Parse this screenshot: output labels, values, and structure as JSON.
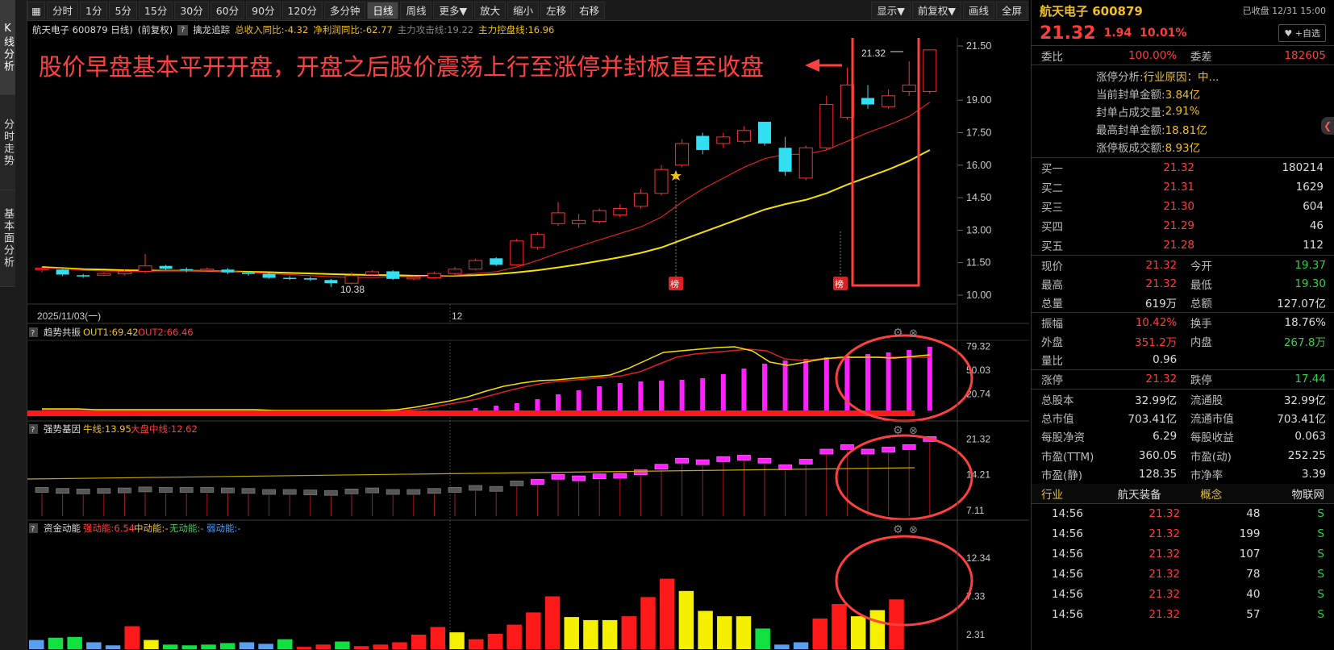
{
  "left_tabs": [
    {
      "label": "K线分析",
      "active": true
    },
    {
      "label": "分时走势",
      "active": false
    },
    {
      "label": "基本面分析",
      "active": false
    }
  ],
  "toolbar": {
    "periods": [
      "分时",
      "1分",
      "5分",
      "15分",
      "30分",
      "60分",
      "90分",
      "120分",
      "多分钟",
      "日线",
      "周线",
      "更多▼"
    ],
    "active_period": "日线",
    "actions": [
      "放大",
      "缩小",
      "左移",
      "右移"
    ],
    "display": "显示▼",
    "adjust": "前复权▼",
    "draw": "画线",
    "fullscreen": "全屏"
  },
  "info_bar": {
    "stock": "航天电子 600879 日线)",
    "adjust": "(前复权)",
    "indicator": "擒龙追踪",
    "rev": "总收入同比:-4.32",
    "profit": "净利润同比:-62.77",
    "attack": "主力攻击线:19.22",
    "control": "主力控盘线:16.96"
  },
  "chart": {
    "annotation": "股价早盘基本平开开盘，开盘之后股价震荡上行至涨停并封板直至收盘",
    "date_left": "2025/11/03(一)",
    "date_mid": "12",
    "high_label": "21.32",
    "low_label": "10.38",
    "badge": "榜",
    "price_ticks": [
      "21.50",
      "19.00",
      "17.50",
      "16.00",
      "14.50",
      "13.00",
      "11.50",
      "10.00"
    ],
    "panel1": {
      "name": "趋势共振",
      "out1": "OUT1:69.42",
      "out2": "OUT2:66.46",
      "ticks": [
        "79.32",
        "50.03",
        "20.74"
      ]
    },
    "panel2": {
      "name": "强势基因",
      "niu": "牛线:13.95",
      "dapan": "大盘中线:12.62",
      "ticks": [
        "21.32",
        "14.21",
        "7.11"
      ]
    },
    "panel3": {
      "name": "资金动能",
      "strong": "强动能:6.54",
      "mid": "中动能:-",
      "none": "无动能:-",
      "weak": "弱动能:-",
      "ticks": [
        "12.34",
        "7.33",
        "2.31"
      ]
    }
  },
  "chart_data": {
    "type": "candlestick",
    "candles": [
      [
        11.18,
        11.25,
        11.05,
        11.3
      ],
      [
        11.18,
        10.95,
        10.88,
        11.22
      ],
      [
        10.92,
        10.88,
        10.8,
        10.98
      ],
      [
        10.92,
        11.0,
        10.88,
        11.05
      ],
      [
        10.98,
        11.1,
        10.92,
        11.18
      ],
      [
        11.1,
        11.35,
        11.0,
        11.9
      ],
      [
        11.35,
        11.22,
        11.15,
        11.4
      ],
      [
        11.2,
        11.18,
        11.05,
        11.28
      ],
      [
        11.15,
        11.2,
        11.1,
        11.28
      ],
      [
        11.18,
        11.05,
        10.98,
        11.25
      ],
      [
        11.05,
        10.98,
        10.9,
        11.12
      ],
      [
        10.98,
        10.8,
        10.75,
        11.02
      ],
      [
        10.8,
        10.78,
        10.7,
        10.88
      ],
      [
        10.78,
        10.72,
        10.65,
        10.85
      ],
      [
        10.7,
        10.55,
        10.38,
        10.75
      ],
      [
        10.55,
        10.9,
        10.5,
        11.05
      ],
      [
        10.95,
        11.08,
        10.9,
        11.15
      ],
      [
        11.1,
        10.75,
        10.7,
        11.15
      ],
      [
        10.75,
        10.82,
        10.7,
        10.9
      ],
      [
        10.8,
        11.0,
        10.78,
        11.08
      ],
      [
        11.0,
        11.2,
        10.95,
        11.3
      ],
      [
        11.2,
        11.6,
        11.15,
        11.68
      ],
      [
        11.7,
        11.4,
        11.35,
        11.75
      ],
      [
        11.4,
        12.5,
        11.35,
        12.6
      ],
      [
        12.2,
        12.8,
        12.1,
        12.9
      ],
      [
        13.3,
        13.8,
        13.2,
        14.3
      ],
      [
        13.3,
        13.45,
        13.1,
        13.75
      ],
      [
        13.4,
        13.9,
        13.3,
        14.0
      ],
      [
        13.7,
        14.0,
        13.6,
        14.2
      ],
      [
        14.1,
        14.7,
        14.0,
        14.9
      ],
      [
        14.7,
        15.8,
        14.6,
        16.0
      ],
      [
        16.0,
        17.0,
        15.9,
        17.2
      ],
      [
        17.35,
        16.7,
        16.5,
        17.5
      ],
      [
        17.0,
        17.3,
        16.8,
        17.5
      ],
      [
        17.1,
        17.6,
        17.0,
        17.8
      ],
      [
        18.0,
        17.0,
        16.9,
        18.0
      ],
      [
        16.8,
        15.7,
        15.5,
        17.3
      ],
      [
        15.4,
        16.8,
        15.3,
        16.9
      ],
      [
        16.8,
        18.8,
        16.7,
        19.2
      ],
      [
        18.2,
        19.7,
        18.1,
        20.5
      ],
      [
        19.1,
        18.8,
        18.6,
        19.7
      ],
      [
        18.7,
        19.2,
        18.6,
        19.5
      ],
      [
        19.4,
        19.7,
        19.2,
        20.8
      ],
      [
        19.4,
        21.32,
        19.3,
        21.32
      ]
    ],
    "ma_red": [
      11.25,
      11.22,
      11.15,
      11.12,
      11.1,
      11.1,
      11.12,
      11.12,
      11.12,
      11.1,
      11.05,
      11.0,
      10.95,
      10.9,
      10.85,
      10.82,
      10.82,
      10.85,
      10.85,
      10.88,
      10.92,
      11.0,
      11.08,
      11.3,
      11.6,
      11.95,
      12.25,
      12.55,
      12.85,
      13.15,
      13.6,
      14.3,
      14.9,
      15.4,
      15.9,
      16.3,
      16.5,
      16.5,
      16.7,
      17.1,
      17.5,
      17.85,
      18.25,
      18.9
    ],
    "ma_yellow": [
      11.3,
      11.25,
      11.2,
      11.18,
      11.15,
      11.14,
      11.13,
      11.13,
      11.12,
      11.1,
      11.08,
      11.06,
      11.03,
      11.0,
      10.97,
      10.95,
      10.93,
      10.92,
      10.9,
      10.89,
      10.9,
      10.92,
      10.97,
      11.05,
      11.15,
      11.28,
      11.42,
      11.58,
      11.75,
      11.95,
      12.2,
      12.55,
      12.9,
      13.25,
      13.6,
      13.95,
      14.2,
      14.4,
      14.7,
      15.1,
      15.45,
      15.8,
      16.2,
      16.7
    ],
    "panel1_bars": [
      0,
      0,
      0,
      0,
      0,
      0,
      0,
      0,
      0,
      0,
      0,
      0,
      0,
      0,
      0,
      0,
      0,
      0,
      0,
      0,
      0,
      3,
      6,
      9,
      14,
      20,
      25,
      30,
      34,
      36,
      37,
      38,
      40,
      45,
      52,
      58,
      62,
      64,
      66,
      68,
      70,
      72,
      75,
      79
    ],
    "panel1_line_yellow": [
      2,
      2,
      2,
      1,
      1,
      1,
      1,
      1,
      1,
      1,
      1,
      1,
      1,
      0,
      0,
      0,
      0,
      0,
      0,
      0,
      1,
      4,
      8,
      12,
      17,
      24,
      30,
      34,
      37,
      38,
      40,
      42,
      44,
      52,
      62,
      72,
      74,
      76,
      78,
      79,
      74,
      60,
      56,
      60,
      64,
      66,
      66,
      66,
      65,
      67,
      69
    ],
    "panel1_line_red": [
      1,
      1,
      1,
      1,
      1,
      1,
      1,
      1,
      1,
      1,
      1,
      1,
      1,
      0,
      0,
      0,
      0,
      0,
      0,
      0,
      0,
      2,
      6,
      10,
      14,
      20,
      26,
      31,
      35,
      37,
      39,
      41,
      43,
      48,
      57,
      66,
      70,
      72,
      74,
      76,
      74,
      64,
      62,
      64,
      65,
      66,
      66,
      66,
      66,
      66
    ],
    "panel2_values": [
      11.2,
      11.0,
      10.9,
      11.0,
      11.1,
      11.3,
      11.2,
      11.2,
      11.2,
      11.1,
      11.0,
      10.8,
      10.8,
      10.7,
      10.6,
      10.9,
      11.1,
      10.8,
      10.8,
      11.0,
      11.2,
      11.6,
      11.4,
      12.5,
      12.8,
      13.8,
      13.5,
      13.9,
      14.0,
      14.7,
      15.8,
      17.0,
      16.7,
      17.3,
      17.6,
      17.0,
      15.7,
      16.8,
      18.8,
      19.7,
      18.8,
      19.2,
      19.7,
      21.3
    ],
    "panel3_values": [
      1.2,
      1.5,
      1.6,
      0.9,
      0.5,
      3.0,
      1.2,
      0.6,
      0.5,
      0.6,
      0.8,
      0.9,
      0.7,
      1.3,
      0.3,
      0.6,
      1.0,
      0.4,
      0.6,
      0.9,
      1.9,
      2.9,
      2.2,
      1.3,
      2.0,
      3.2,
      4.8,
      6.9,
      4.2,
      3.8,
      3.8,
      4.3,
      6.8,
      9.2,
      7.6,
      5.0,
      4.3,
      4.3,
      2.7,
      0.6,
      0.9,
      4.0,
      5.9,
      4.3,
      5.1,
      6.5
    ],
    "panel3_colors": [
      "blue",
      "green",
      "green",
      "blue",
      "blue",
      "red",
      "yellow",
      "green",
      "green",
      "green",
      "green",
      "blue",
      "blue",
      "green",
      "red",
      "red",
      "green",
      "red",
      "red",
      "red",
      "red",
      "red",
      "yellow",
      "red",
      "red",
      "red",
      "red",
      "red",
      "yellow",
      "yellow",
      "yellow",
      "red",
      "red",
      "red",
      "yellow",
      "yellow",
      "yellow",
      "yellow",
      "green",
      "blue",
      "blue",
      "red",
      "red",
      "yellow",
      "yellow",
      "red"
    ],
    "y_range": [
      10.0,
      21.5
    ]
  },
  "right_panel": {
    "stock_title": "航天电子 600879",
    "status": "已收盘 12/31 15:00",
    "price": "21.32",
    "change": "1.94",
    "pct": "10.01%",
    "add_watch": "♥ +自选",
    "weibi_lbl": "委比",
    "weibi": "100.00%",
    "weicha_lbl": "委差",
    "weicha": "182605",
    "zt": [
      {
        "lbl": "涨停分析:",
        "val": "行业原因：中..."
      },
      {
        "lbl": "当前封单金额:",
        "val": "3.84亿"
      },
      {
        "lbl": "封单占成交量:",
        "val": "2.91%"
      },
      {
        "lbl": "最高封单金额:",
        "val": "18.81亿"
      },
      {
        "lbl": "涨停板成交额:",
        "val": "8.93亿"
      }
    ],
    "book": [
      {
        "lbl": "买一",
        "price": "21.32",
        "vol": "180214"
      },
      {
        "lbl": "买二",
        "price": "21.31",
        "vol": "1629"
      },
      {
        "lbl": "买三",
        "price": "21.30",
        "vol": "604"
      },
      {
        "lbl": "买四",
        "price": "21.29",
        "vol": "46"
      },
      {
        "lbl": "买五",
        "price": "21.28",
        "vol": "112"
      }
    ],
    "stats": [
      {
        "l1": "现价",
        "v1": "21.32",
        "c1": "red",
        "l2": "今开",
        "v2": "19.37",
        "c2": "green"
      },
      {
        "l1": "最高",
        "v1": "21.32",
        "c1": "red",
        "l2": "最低",
        "v2": "19.30",
        "c2": "green"
      },
      {
        "l1": "总量",
        "v1": "619万",
        "c1": "white",
        "l2": "总额",
        "v2": "127.07亿",
        "c2": "white"
      },
      {
        "l1": "振幅",
        "v1": "10.42%",
        "c1": "red",
        "l2": "换手",
        "v2": "18.76%",
        "c2": "white"
      },
      {
        "l1": "外盘",
        "v1": "351.2万",
        "c1": "red",
        "l2": "内盘",
        "v2": "267.8万",
        "c2": "green"
      },
      {
        "l1": "量比",
        "v1": "0.96",
        "c1": "white",
        "l2": "",
        "v2": "",
        "c2": "white"
      },
      {
        "l1": "涨停",
        "v1": "21.32",
        "c1": "red",
        "l2": "跌停",
        "v2": "17.44",
        "c2": "green"
      },
      {
        "l1": "总股本",
        "v1": "32.99亿",
        "c1": "white",
        "l2": "流通股",
        "v2": "32.99亿",
        "c2": "white"
      },
      {
        "l1": "总市值",
        "v1": "703.41亿",
        "c1": "white",
        "l2": "流通市值",
        "v2": "703.41亿",
        "c2": "white"
      },
      {
        "l1": "每股净资",
        "v1": "6.29",
        "c1": "white",
        "l2": "每股收益",
        "v2": "0.063",
        "c2": "white"
      },
      {
        "l1": "市盈(TTM)",
        "v1": "360.05",
        "c1": "white",
        "l2": "市盈(动)",
        "v2": "252.25",
        "c2": "white"
      },
      {
        "l1": "市盈(静)",
        "v1": "128.35",
        "c1": "white",
        "l2": "市净率",
        "v2": "3.39",
        "c2": "white"
      }
    ],
    "industry": {
      "label": "行业",
      "value": "航天装备",
      "concept_label": "概念",
      "concept": "物联网"
    },
    "ticks": [
      {
        "t": "14:56",
        "p": "21.32",
        "v": "48",
        "s": "S"
      },
      {
        "t": "14:56",
        "p": "21.32",
        "v": "199",
        "s": "S"
      },
      {
        "t": "14:56",
        "p": "21.32",
        "v": "107",
        "s": "S"
      },
      {
        "t": "14:56",
        "p": "21.32",
        "v": "78",
        "s": "S"
      },
      {
        "t": "14:56",
        "p": "21.32",
        "v": "40",
        "s": "S"
      },
      {
        "t": "14:56",
        "p": "21.32",
        "v": "57",
        "s": "S"
      }
    ]
  }
}
